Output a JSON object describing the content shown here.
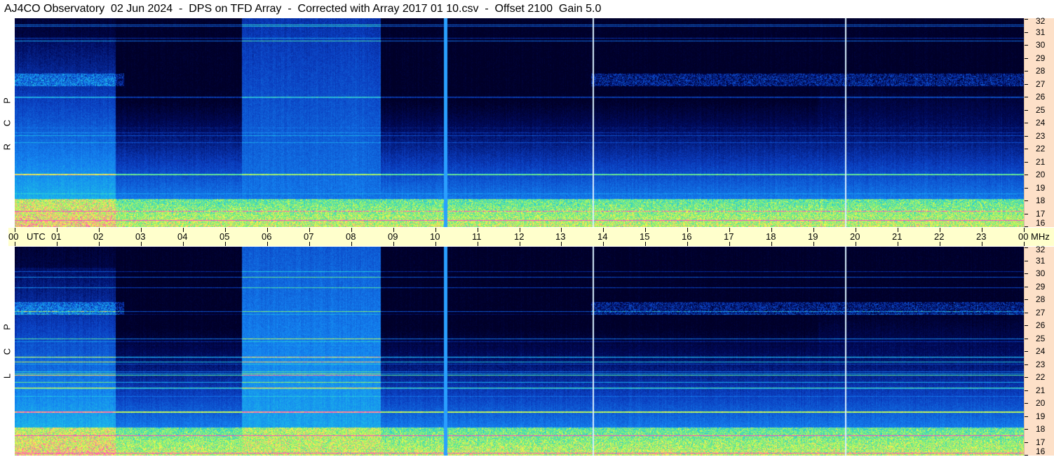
{
  "title": "AJ4CO Observatory  02 Jun 2024  -  DPS on TFD Array  -  Corrected with Array 2017 01 10.csv  -  Offset 2100  Gain 5.0",
  "time_axis": {
    "labels": [
      "00",
      "01",
      "02",
      "03",
      "04",
      "05",
      "06",
      "07",
      "08",
      "09",
      "10",
      "11",
      "12",
      "13",
      "14",
      "15",
      "16",
      "17",
      "18",
      "19",
      "20",
      "21",
      "22",
      "23",
      "00"
    ],
    "utc_label": "UTC",
    "mhz_label": "MHz"
  },
  "panels": [
    {
      "id": "rcp",
      "side_letters": [
        "R",
        "C",
        "P"
      ]
    },
    {
      "id": "lcp",
      "side_letters": [
        "L",
        "C",
        "P"
      ]
    }
  ],
  "chart_data": [
    {
      "type": "heatmap",
      "title": "AJ4CO Observatory  02 Jun 2024  -  DPS on TFD Array  -  Corrected with Array 2017 01 10.csv  -  Offset 2100  Gain 5.0",
      "panel": "RCP",
      "x_unit": "UTC",
      "x_range": [
        0,
        24
      ],
      "y_unit": "MHz",
      "y_range": [
        16,
        32
      ],
      "y_ticks": [
        16,
        17,
        18,
        19,
        20,
        21,
        22,
        23,
        24,
        25,
        26,
        27,
        28,
        29,
        30,
        31,
        32
      ],
      "colors": {
        "background": "#00002a",
        "low": "#001a66",
        "mid": "#1e6fe0",
        "high": "#1fd0e0",
        "hot": "#ffff40",
        "peak": "#ff40c0"
      }
    },
    {
      "type": "heatmap",
      "panel": "LCP",
      "x_unit": "UTC",
      "x_range": [
        0,
        24
      ],
      "y_unit": "MHz",
      "y_range": [
        16,
        32
      ],
      "y_ticks": [
        16,
        17,
        18,
        19,
        20,
        21,
        22,
        23,
        24,
        25,
        26,
        27,
        28,
        29,
        30,
        31,
        32
      ],
      "colors": {
        "background": "#00002a",
        "low": "#001a66",
        "mid": "#1e6fe0",
        "high": "#1fd0e0",
        "hot": "#ffff40",
        "peak": "#ff40c0"
      }
    }
  ]
}
